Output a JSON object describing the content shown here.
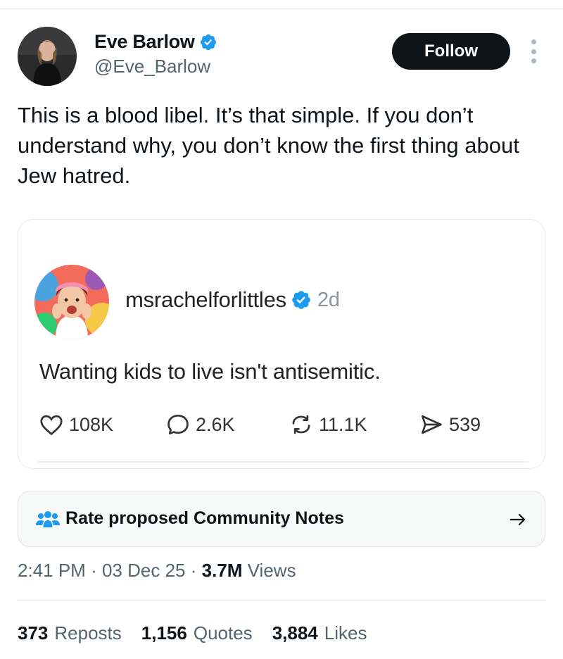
{
  "author": {
    "name": "Eve Barlow",
    "handle": "@Eve_Barlow",
    "verified": true,
    "follow_label": "Follow"
  },
  "tweet": {
    "text": "This is a blood libel. It’s that simple. If you don’t understand why, you don’t know the first thing about Jew hatred."
  },
  "quoted": {
    "username": "msrachelforlittles",
    "verified": true,
    "time": "2d",
    "text": "Wanting kids to live isn't antisemitic.",
    "actions": {
      "likes": "108K",
      "comments": "2.6K",
      "reposts": "11.1K",
      "shares": "539"
    }
  },
  "community_notes": {
    "label": "Rate proposed Community Notes"
  },
  "meta": {
    "time": "2:41 PM",
    "sep": "·",
    "date": "03 Dec 25",
    "views_count": "3.7M",
    "views_label": "Views"
  },
  "stats": {
    "reposts_count": "373",
    "reposts_label": "Reposts",
    "quotes_count": "1,156",
    "quotes_label": "Quotes",
    "likes_count": "3,884",
    "likes_label": "Likes"
  },
  "colors": {
    "verified_blue": "#1d9bf0",
    "text_primary": "#0f1419",
    "text_secondary": "#536471",
    "follow_bg": "#0f1419"
  },
  "icons": [
    "verified-badge-icon",
    "more-vertical-icon",
    "heart-icon",
    "comment-icon",
    "repost-icon",
    "share-icon",
    "community-notes-icon",
    "arrow-right-icon"
  ]
}
